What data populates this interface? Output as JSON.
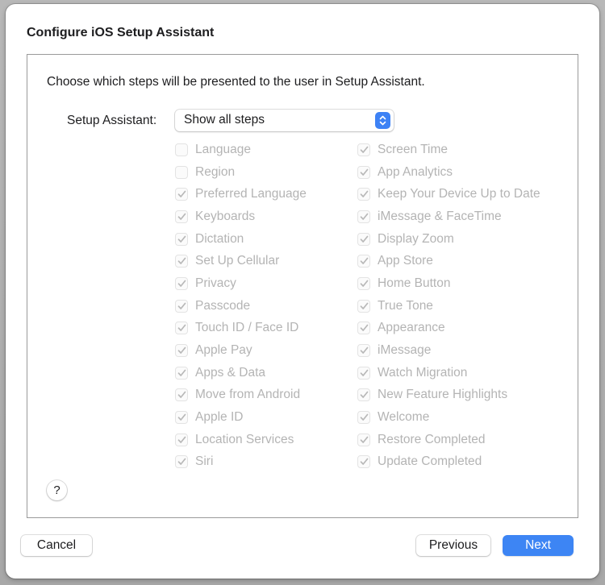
{
  "dialog": {
    "title": "Configure iOS Setup Assistant",
    "intro": "Choose which steps will be presented to the user in Setup Assistant.",
    "setup_assistant_label": "Setup Assistant:",
    "setup_assistant_value": "Show all steps",
    "accent_color": "#3d82f5"
  },
  "steps_left": [
    {
      "label": "Language",
      "checked": false
    },
    {
      "label": "Region",
      "checked": false
    },
    {
      "label": "Preferred Language",
      "checked": true
    },
    {
      "label": "Keyboards",
      "checked": true
    },
    {
      "label": "Dictation",
      "checked": true
    },
    {
      "label": "Set Up Cellular",
      "checked": true
    },
    {
      "label": "Privacy",
      "checked": true
    },
    {
      "label": "Passcode",
      "checked": true
    },
    {
      "label": "Touch ID / Face ID",
      "checked": true
    },
    {
      "label": "Apple Pay",
      "checked": true
    },
    {
      "label": "Apps & Data",
      "checked": true
    },
    {
      "label": "Move from Android",
      "checked": true
    },
    {
      "label": "Apple ID",
      "checked": true
    },
    {
      "label": "Location Services",
      "checked": true
    },
    {
      "label": "Siri",
      "checked": true
    }
  ],
  "steps_right": [
    {
      "label": "Screen Time",
      "checked": true
    },
    {
      "label": "App Analytics",
      "checked": true
    },
    {
      "label": "Keep Your Device Up to Date",
      "checked": true
    },
    {
      "label": "iMessage & FaceTime",
      "checked": true
    },
    {
      "label": "Display Zoom",
      "checked": true
    },
    {
      "label": "App Store",
      "checked": true
    },
    {
      "label": "Home Button",
      "checked": true
    },
    {
      "label": "True Tone",
      "checked": true
    },
    {
      "label": "Appearance",
      "checked": true
    },
    {
      "label": "iMessage",
      "checked": true
    },
    {
      "label": "Watch Migration",
      "checked": true
    },
    {
      "label": "New Feature Highlights",
      "checked": true
    },
    {
      "label": "Welcome",
      "checked": true
    },
    {
      "label": "Restore Completed",
      "checked": true
    },
    {
      "label": "Update Completed",
      "checked": true
    }
  ],
  "help": {
    "label": "?"
  },
  "buttons": {
    "cancel": "Cancel",
    "previous": "Previous",
    "next": "Next"
  }
}
